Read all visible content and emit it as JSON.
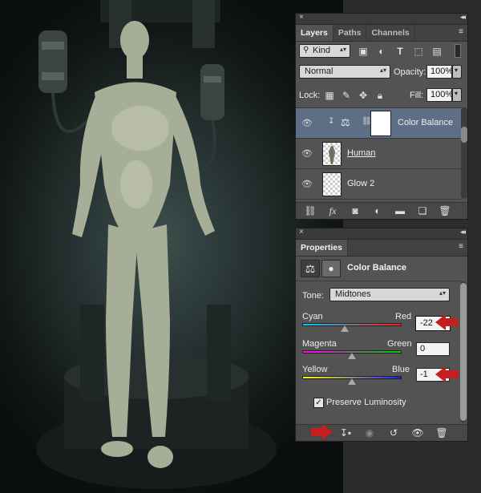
{
  "layers_panel": {
    "tabs": [
      "Layers",
      "Paths",
      "Channels"
    ],
    "filter_kind": "Kind",
    "blend_mode": "Normal",
    "opacity_label": "Opacity:",
    "opacity_value": "100%",
    "lock_label": "Lock:",
    "fill_label": "Fill:",
    "fill_value": "100%",
    "layers": [
      {
        "name": "Color Balance",
        "selected": true
      },
      {
        "name": "Human",
        "selected": false
      },
      {
        "name": "Glow 2",
        "selected": false
      }
    ]
  },
  "properties_panel": {
    "tab": "Properties",
    "adjustment_title": "Color Balance",
    "tone_label": "Tone:",
    "tone_value": "Midtones",
    "sliders": [
      {
        "left": "Cyan",
        "right": "Red",
        "value": "-22",
        "position": 0.39
      },
      {
        "left": "Magenta",
        "right": "Green",
        "value": "0",
        "position": 0.5
      },
      {
        "left": "Yellow",
        "right": "Blue",
        "value": "-1",
        "position": 0.5
      }
    ],
    "preserve_luminosity_label": "Preserve Luminosity",
    "preserve_luminosity_checked": true
  },
  "colors": {
    "selected_layer": "#5d6e86",
    "annotation_arrow": "#c41e1e"
  }
}
